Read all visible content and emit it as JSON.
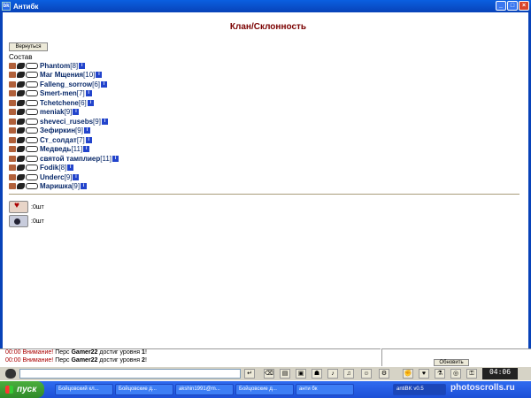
{
  "window": {
    "title": "Антибк",
    "buttons": [
      "_",
      "□",
      "×"
    ]
  },
  "page": {
    "title": "Клан/Склонность",
    "back_button": "Вернуться",
    "section": "Состав"
  },
  "members": [
    {
      "name": "Phantom",
      "level": "[8]"
    },
    {
      "name": "Маг Мщения",
      "level": "[10]"
    },
    {
      "name": "Falleng_sorrow",
      "level": "[6]"
    },
    {
      "name": "Smert-men",
      "level": "[7]"
    },
    {
      "name": "Tchetchene",
      "level": "[6]"
    },
    {
      "name": "meniak",
      "level": "[9]"
    },
    {
      "name": "sheveci_rusebs",
      "level": "[9]"
    },
    {
      "name": "Зефиркин",
      "level": "[9]"
    },
    {
      "name": "Ст_солдат",
      "level": "[7]"
    },
    {
      "name": "Медведь",
      "level": "[11]"
    },
    {
      "name": "святой тамплиер",
      "level": "[11]"
    },
    {
      "name": "Fodik",
      "level": "[8]"
    },
    {
      "name": "Underc",
      "level": "[9]"
    },
    {
      "name": "Маришка",
      "level": "[9]"
    }
  ],
  "info_icon": "i",
  "alignment": [
    {
      "icon": "heart-scroll-icon",
      "label": ":0шт"
    },
    {
      "icon": "dark-scroll-icon",
      "label": ":0шт"
    }
  ],
  "chat": [
    {
      "time": "00:00",
      "warn": "Внимание!",
      "pre": "Перс",
      "name": "Gamer22",
      "text": "достиг уровня",
      "level": "1",
      "end": "!"
    },
    {
      "time": "00:00",
      "warn": "Внимание!",
      "pre": "Перс",
      "name": "Gamer22",
      "text": "достиг уровня",
      "level": "2",
      "end": "!"
    }
  ],
  "refresh_button": "Обновить",
  "clock": "04:06",
  "start": "пуск",
  "tasks": [
    "Бойцовский кл...",
    "Бойцовские д...",
    "akshin1991@m...",
    "Бойцовские д...",
    "анти бк",
    "antiBK v0.5"
  ],
  "watermark": "photoscrolls.ru",
  "colors": {
    "title": "#7a0000",
    "member": "#0a2a6a",
    "chat_warn": "#aa0000",
    "taskbar": "#2f6bf0",
    "start": "#4bae3c"
  }
}
